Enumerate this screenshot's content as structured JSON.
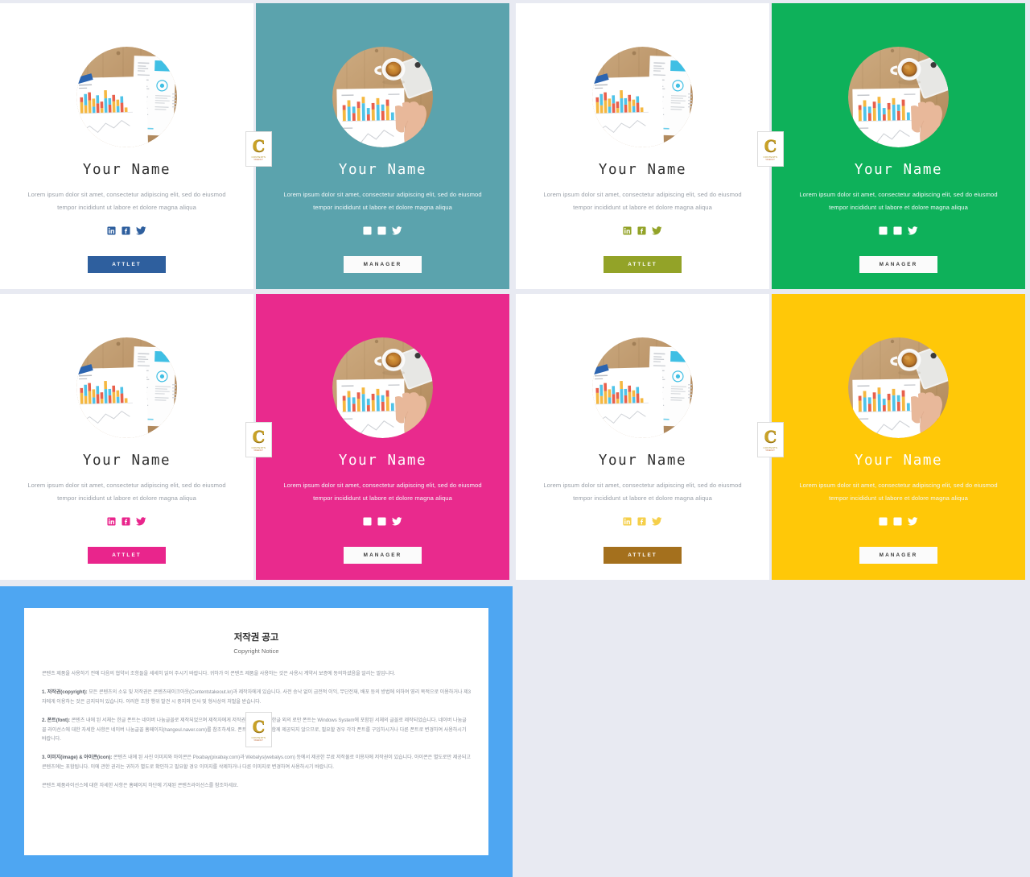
{
  "page": {
    "background": "#e8eaf2",
    "card_gap_color": "#eaedf5"
  },
  "cards": [
    {
      "id": "card-1",
      "style": "light",
      "photo": "desk-chart-report",
      "name": "Your Name",
      "bio": "Lorem ipsum dolor sit amet, consectetur adipiscing elit, sed do eiusmod tempor incididunt ut labore et dolore magna aliqua",
      "socials": [
        "linkedin-icon",
        "facebook-icon",
        "twitter-icon"
      ],
      "cta_label": "ATTLET",
      "accent": "#2e5f9e",
      "background": "#ffffff"
    },
    {
      "id": "card-2",
      "style": "solid",
      "photo": "desk-coffee-chart-hand",
      "name": "Your Name",
      "bio": "Lorem ipsum dolor sit amet, consectetur adipiscing elit, sed do eiusmod tempor incididunt ut labore et dolore magna aliqua",
      "socials": [
        "linkedin-icon",
        "facebook-icon",
        "twitter-icon"
      ],
      "cta_label": "MANAGER",
      "accent": "#ffffff",
      "background": "#5ba3ad"
    },
    {
      "id": "card-3",
      "style": "light",
      "photo": "desk-chart-report",
      "name": "Your Name",
      "bio": "Lorem ipsum dolor sit amet, consectetur adipiscing elit, sed do eiusmod tempor incididunt ut labore et dolore magna aliqua",
      "socials": [
        "linkedin-icon",
        "facebook-icon",
        "twitter-icon"
      ],
      "cta_label": "ATTLET",
      "accent": "#93a328",
      "background": "#ffffff"
    },
    {
      "id": "card-4",
      "style": "solid",
      "photo": "desk-coffee-chart-hand",
      "name": "Your Name",
      "bio": "Lorem ipsum dolor sit amet, consectetur adipiscing elit, sed do eiusmod tempor incididunt ut labore et dolore magna aliqua",
      "socials": [
        "linkedin-icon",
        "facebook-icon",
        "twitter-icon"
      ],
      "cta_label": "MANAGER",
      "accent": "#ffffff",
      "background": "#0eb15a"
    },
    {
      "id": "card-5",
      "style": "light",
      "photo": "desk-chart-report",
      "name": "Your Name",
      "bio": "Lorem ipsum dolor sit amet, consectetur adipiscing elit, sed do eiusmod tempor incididunt ut labore et dolore magna aliqua",
      "socials": [
        "linkedin-icon",
        "facebook-icon",
        "twitter-icon"
      ],
      "cta_label": "ATTLET",
      "accent": "#e9258c",
      "background": "#ffffff"
    },
    {
      "id": "card-6",
      "style": "solid",
      "photo": "desk-coffee-chart-hand",
      "name": "Your Name",
      "bio": "Lorem ipsum dolor sit amet, consectetur adipiscing elit, sed do eiusmod tempor incididunt ut labore et dolore magna aliqua",
      "socials": [
        "linkedin-icon",
        "facebook-icon",
        "twitter-icon"
      ],
      "cta_label": "MANAGER",
      "accent": "#ffffff",
      "background": "#e92a8d"
    },
    {
      "id": "card-7",
      "style": "light",
      "photo": "desk-chart-report",
      "name": "Your Name",
      "bio": "Lorem ipsum dolor sit amet, consectetur adipiscing elit, sed do eiusmod tempor incididunt ut labore et dolore magna aliqua",
      "socials": [
        "linkedin-icon",
        "facebook-icon",
        "twitter-icon"
      ],
      "cta_label": "ATTLET",
      "accent": "#a4701d",
      "icon_color": "#f5cf4a",
      "background": "#ffffff"
    },
    {
      "id": "card-8",
      "style": "solid",
      "photo": "desk-coffee-chart-hand",
      "name": "Your Name",
      "bio": "Lorem ipsum dolor sit amet, consectetur adipiscing elit, sed do eiusmod tempor incididunt ut labore et dolore magna aliqua",
      "socials": [
        "linkedin-icon",
        "facebook-icon",
        "twitter-icon"
      ],
      "cta_label": "MANAGER",
      "accent": "#ffffff",
      "background": "#ffc808"
    }
  ],
  "watermark": {
    "letter": "C",
    "title": "CONTENTS",
    "subtitle": "TAKEOUT"
  },
  "copyright": {
    "frame_color": "#4ea6f2",
    "title": "저작권 공고",
    "subtitle": "Copyright Notice",
    "intro": "콘텐츠 제품을 사용하기 전에 다음의 협약서 조항들을 세세히 읽어 주시기 바랍니다. 귀하가 이 콘텐츠 제품을 사용하는 것은 사용시 계약서 보증에 동의하셨음을 알리는 말입니다.",
    "sections": [
      {
        "label": "1. 저작권(copyright):",
        "text": " 모든 콘텐츠의 소유 및 저작권은 콘텐츠테이크아웃(Contentstakeout.kr)과 제작자에게 있습니다. 사전 승낙 없이 금전적 이익, 무단전재, 배포 등의 방법에 의하여 영리 목적으로 이용하거나 제3자에게 이용하는 것은 금지되어 있습니다. 이러한 조항 행위 발견 시 중지와 민사 및 형사상의 처벌을 받습니다."
      },
      {
        "label": "2. 폰트(font):",
        "text": " 콘텐츠 내에 된 서체는 한글 폰트는 네이버 나눔글꼴로 제작되었으며 제작자에게 저작권이 있습니다. 한글 외의 로만 폰트는 Windows System에 포함된 서체의 글꼴로 제작되었습니다. 네이버 나눔글꼴 라이선스에 대한 자세한 사항은 네이버 나눔글꼴 홈페이지(hangeul.naver.com)를 참조하세요. 폰트는 콘텐츠의 함께 제공되지 않으므로, 필요할 경우 각각 폰트를 구입하시거나 다른 폰트로 변경하여 사용하시기 바랍니다."
      },
      {
        "label": "3. 이미지(image) & 아이콘(icon):",
        "text": " 콘텐츠 내에 된 사진 이미지와 아이콘은 Pixabay(pixabay.com)과 Webalys(webalys.com) 등에서 제공한 무료 저작물로 이용자에 저작권이 있습니다. 아이콘은 별도로만 제공되고 콘텐츠에는 포함됩니다. 이에 관한 권리는 귀하가 별도로 확인하고 필요할 경우 이미지를 삭제하거나 다른 이미지로 변경하여 사용하시기 바랍니다."
      }
    ],
    "footer": "콘텐츠 제품라이선스에 대한 자세한 사항은 홈페이지 하단에 기재된 콘텐츠라이선스를 참조하세요."
  }
}
